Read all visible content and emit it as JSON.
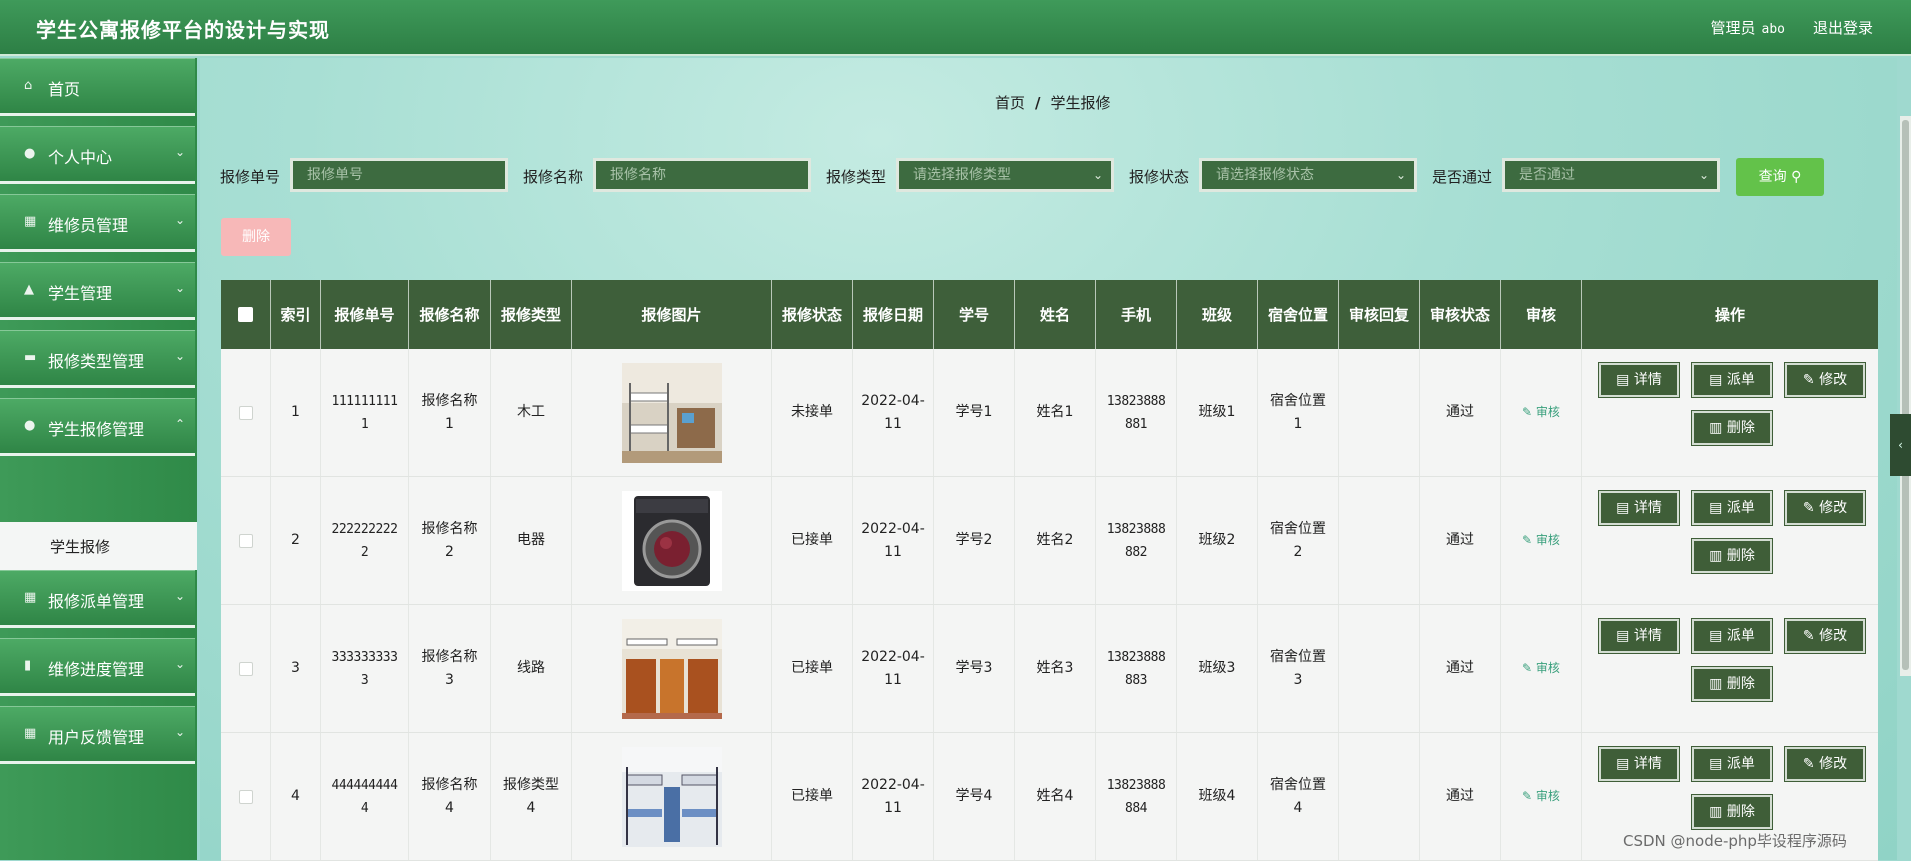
{
  "header": {
    "title": "学生公寓报修平台的设计与实现",
    "user_role": "管理员",
    "user_name": "abo",
    "logout": "退出登录"
  },
  "sidebar": {
    "items": [
      {
        "label": "首页",
        "icon": "home-icon"
      },
      {
        "label": "个人中心",
        "icon": "user-icon"
      },
      {
        "label": "维修员管理",
        "icon": "grid-icon"
      },
      {
        "label": "学生管理",
        "icon": "cap-icon"
      },
      {
        "label": "报修类型管理",
        "icon": "tag-icon"
      },
      {
        "label": "学生报修管理",
        "icon": "user-icon"
      },
      {
        "label": "报修派单管理",
        "icon": "grid-icon"
      },
      {
        "label": "维修进度管理",
        "icon": "bars-icon"
      },
      {
        "label": "用户反馈管理",
        "icon": "grid-icon"
      }
    ],
    "active_sub": "学生报修"
  },
  "breadcrumb": {
    "home": "首页",
    "sep": "/",
    "current": "学生报修"
  },
  "filters": {
    "f1_label": "报修单号",
    "f1_placeholder": "报修单号",
    "f2_label": "报修名称",
    "f2_placeholder": "报修名称",
    "f3_label": "报修类型",
    "f3_placeholder": "请选择报修类型",
    "f4_label": "报修状态",
    "f4_placeholder": "请选择报修状态",
    "f5_label": "是否通过",
    "f5_placeholder": "是否通过",
    "search": "查询",
    "delete": "删除"
  },
  "table": {
    "headers": [
      "索引",
      "报修单号",
      "报修名称",
      "报修类型",
      "报修图片",
      "报修状态",
      "报修日期",
      "学号",
      "姓名",
      "手机",
      "班级",
      "宿舍位置",
      "审核回复",
      "审核状态",
      "审核",
      "操作"
    ],
    "rows": [
      {
        "idx": "1",
        "no_a": "111111111",
        "no_b": "1",
        "name_a": "报修名称",
        "name_b": "1",
        "type_a": "木工",
        "type_b": "",
        "status": "未接单",
        "date_a": "2022-04-",
        "date_b": "11",
        "sid": "学号1",
        "sname": "姓名1",
        "phone_a": "13823888",
        "phone_b": "881",
        "cls": "班级1",
        "dorm_a": "宿舍位置",
        "dorm_b": "1",
        "reply": "",
        "audit": "通过",
        "audit_link": "审核"
      },
      {
        "idx": "2",
        "no_a": "222222222",
        "no_b": "2",
        "name_a": "报修名称",
        "name_b": "2",
        "type_a": "电器",
        "type_b": "",
        "status": "已接单",
        "date_a": "2022-04-",
        "date_b": "11",
        "sid": "学号2",
        "sname": "姓名2",
        "phone_a": "13823888",
        "phone_b": "882",
        "cls": "班级2",
        "dorm_a": "宿舍位置",
        "dorm_b": "2",
        "reply": "",
        "audit": "通过",
        "audit_link": "审核"
      },
      {
        "idx": "3",
        "no_a": "333333333",
        "no_b": "3",
        "name_a": "报修名称",
        "name_b": "3",
        "type_a": "线路",
        "type_b": "",
        "status": "已接单",
        "date_a": "2022-04-",
        "date_b": "11",
        "sid": "学号3",
        "sname": "姓名3",
        "phone_a": "13823888",
        "phone_b": "883",
        "cls": "班级3",
        "dorm_a": "宿舍位置",
        "dorm_b": "3",
        "reply": "",
        "audit": "通过",
        "audit_link": "审核"
      },
      {
        "idx": "4",
        "no_a": "444444444",
        "no_b": "4",
        "name_a": "报修名称",
        "name_b": "4",
        "type_a": "报修类型",
        "type_b": "4",
        "status": "已接单",
        "date_a": "2022-04-",
        "date_b": "11",
        "sid": "学号4",
        "sname": "姓名4",
        "phone_a": "13823888",
        "phone_b": "884",
        "cls": "班级4",
        "dorm_a": "宿舍位置",
        "dorm_b": "4",
        "reply": "",
        "audit": "通过",
        "audit_link": "审核"
      }
    ],
    "ops": {
      "detail": "详情",
      "dispatch": "派单",
      "edit": "修改",
      "delete": "删除"
    }
  },
  "watermark": "CSDN @node-php毕设程序源码",
  "colors": {
    "brand_green": "#2d7f45",
    "table_header": "#3e5f3a",
    "search_green": "#63c24a",
    "delete_pink": "#f7b8b8"
  }
}
